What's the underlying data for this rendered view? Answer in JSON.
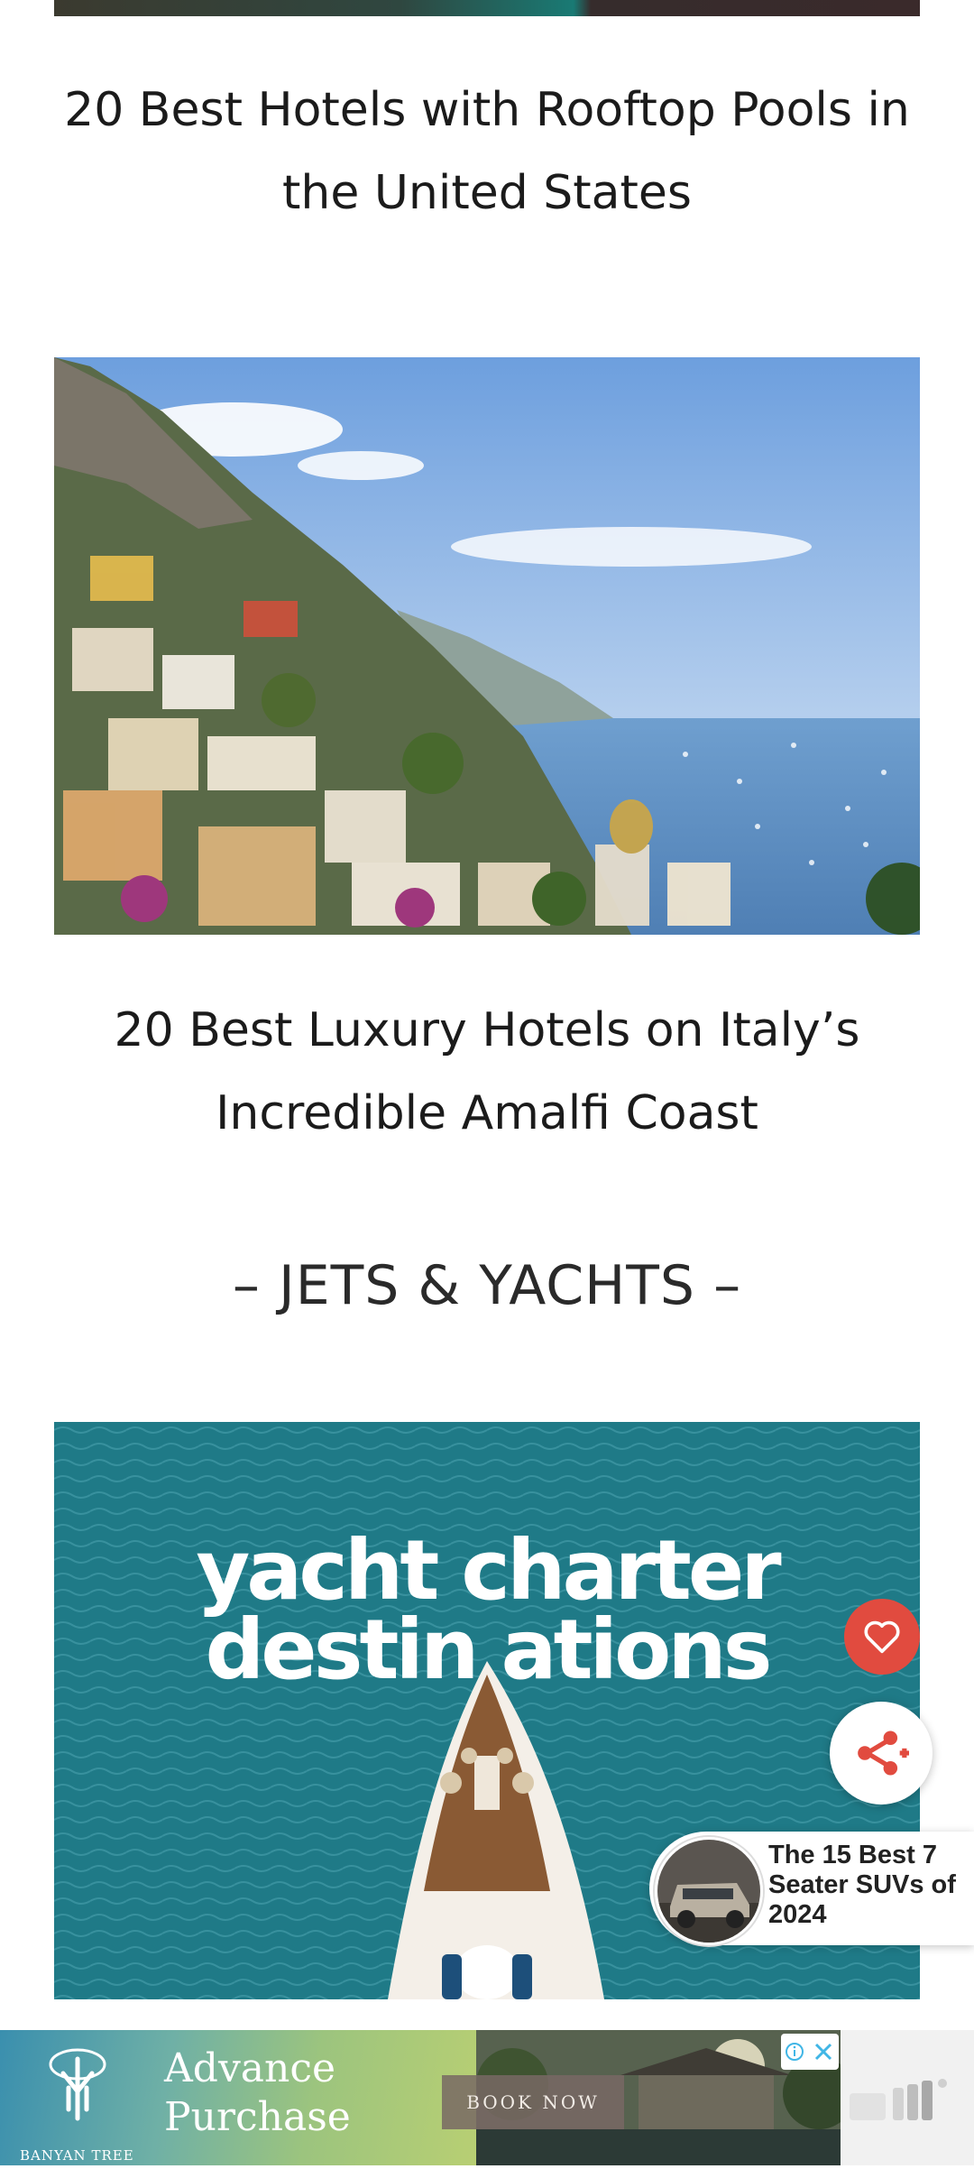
{
  "articles": [
    {
      "title": "20 Best Hotels with Rooftop Pools in the United States"
    },
    {
      "title": "20 Best Luxury Hotels on Italy’s Incredible Amalfi Coast"
    }
  ],
  "section": {
    "heading": "– JETS & YACHTS –"
  },
  "yacht_card": {
    "image_text_line1": "yacht charter",
    "image_text_line2": "destin ations"
  },
  "actions": {
    "favorite_icon": "heart-icon",
    "share_icon": "share-icon"
  },
  "promo": {
    "text": "The 15 Best 7 Seater SUVs of 2024"
  },
  "ad": {
    "headline": "Advance Purchase",
    "brand": "BANYAN TREE",
    "cta": "BOOK NOW",
    "close_icon": "close-icon",
    "info_icon": "info-icon"
  },
  "colors": {
    "favorite_bg": "#e14b3f",
    "share_icon": "#e14b3f"
  }
}
